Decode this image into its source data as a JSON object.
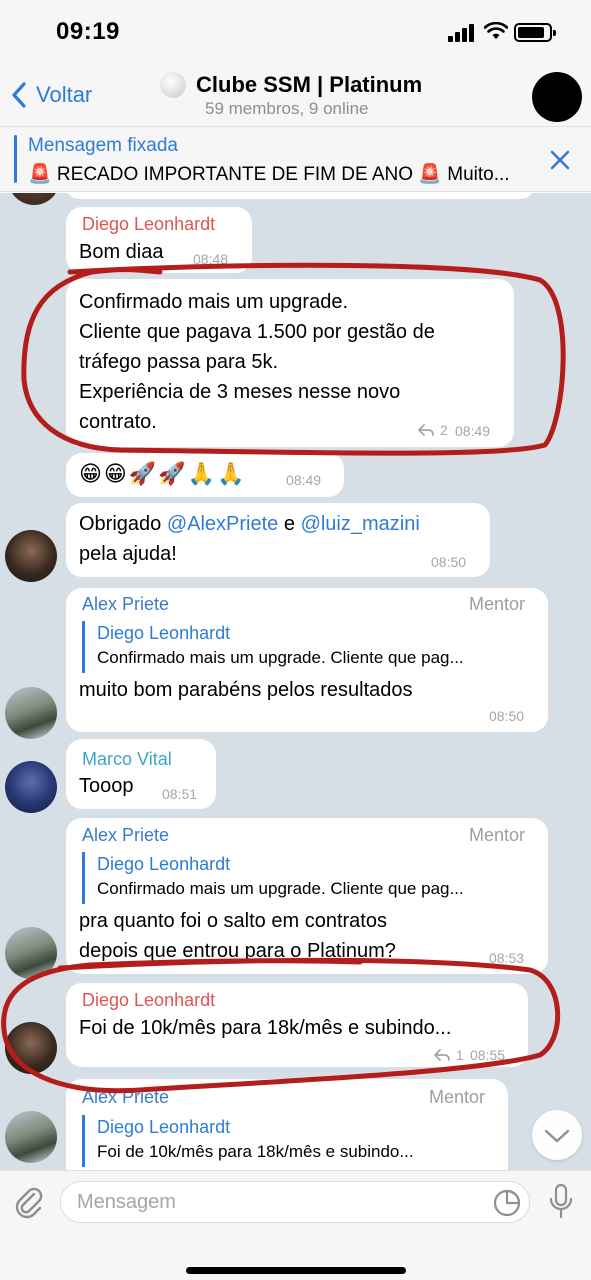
{
  "status_bar": {
    "time": "09:19"
  },
  "header": {
    "back_label": "Voltar",
    "title": "Clube SSM | Platinum",
    "subtitle": "59 membros, 9 online"
  },
  "pinned": {
    "label": "Mensagem fixada",
    "text": "🚨 RECADO IMPORTANTE DE FIM DE ANO 🚨  Muito..."
  },
  "messages": [
    {
      "sender": "Diego Leonhardt",
      "text": "Bom diaa",
      "time": "08:48"
    },
    {
      "lines": [
        "Confirmado mais um upgrade.",
        "Cliente que pagava 1.500 por gestão de",
        "tráfego passa para 5k.",
        "Experiência de 3 meses nesse novo",
        "contrato."
      ],
      "replies": "2",
      "time": "08:49"
    },
    {
      "text": "😁😁🚀🚀🙏🙏",
      "time": "08:49"
    },
    {
      "text_before": "Obrigado ",
      "mention1": "@AlexPriete",
      "text_mid": " e ",
      "mention2": "@luiz_mazini",
      "line2": "pela ajuda!",
      "time": "08:50"
    },
    {
      "sender": "Alex Priete",
      "role": "Mentor",
      "reply_name": "Diego Leonhardt",
      "reply_text": "Confirmado mais um upgrade.  Cliente que pag...",
      "text": "muito bom parabéns pelos resultados",
      "time": "08:50"
    },
    {
      "sender": "Marco Vital",
      "text": "Tooop",
      "time": "08:51"
    },
    {
      "sender": "Alex Priete",
      "role": "Mentor",
      "reply_name": "Diego Leonhardt",
      "reply_text": "Confirmado mais um upgrade.  Cliente que pag...",
      "lines": [
        "pra quanto foi o salto em contratos",
        "depois que entrou para o Platinum?"
      ],
      "time": "08:53"
    },
    {
      "sender": "Diego Leonhardt",
      "text": "Foi de 10k/mês para 18k/mês e subindo...",
      "replies": "1",
      "time": "08:55"
    },
    {
      "sender": "Alex Priete",
      "role": "Mentor",
      "reply_name": "Diego Leonhardt",
      "reply_text": "Foi de 10k/mês para 18k/mês e subindo..."
    }
  ],
  "input": {
    "placeholder": "Mensagem"
  },
  "colors": {
    "accent": "#2f7cd6",
    "diego": "#e0554f",
    "alex": "#3a7bc8",
    "marco": "#3ba7c9",
    "annotation": "#b51d1d",
    "chat_bg": "#d5dfe5"
  }
}
